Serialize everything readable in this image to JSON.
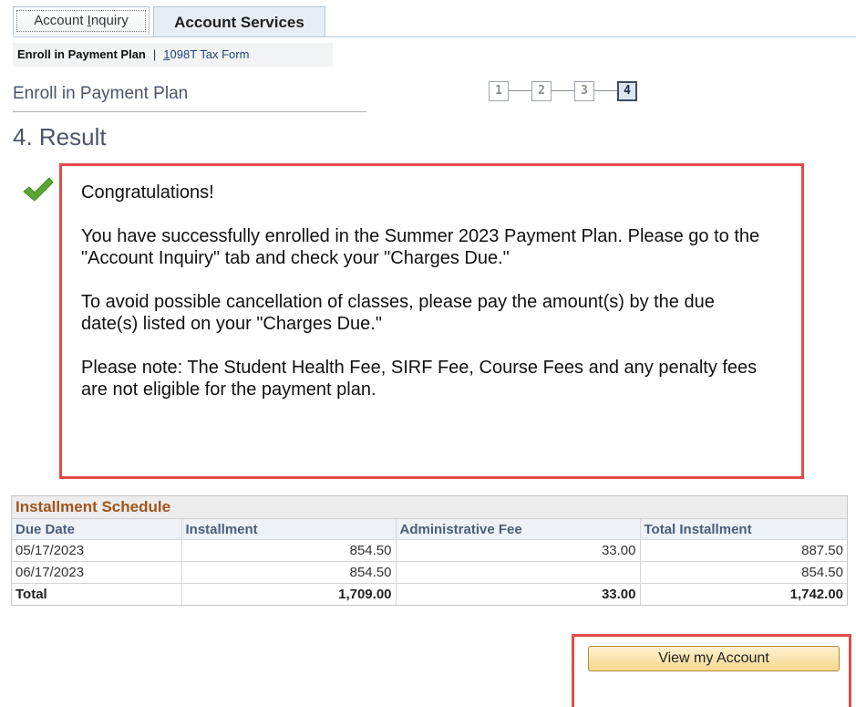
{
  "tabs": [
    {
      "label_prefix": "Account ",
      "label_underlined": "I",
      "label_suffix": "nquiry"
    },
    {
      "label": "Account Services"
    }
  ],
  "subnav": {
    "current": "Enroll in Payment Plan",
    "separator": "|",
    "link_underlined": "1",
    "link_rest": "098T Tax Form"
  },
  "page_title": "Enroll in Payment Plan",
  "steps": [
    "1",
    "2",
    "3",
    "4"
  ],
  "active_step": "4",
  "section_heading": "4. Result",
  "message": {
    "paragraphs": [
      "Congratulations!",
      "You have successfully enrolled in the Summer 2023 Payment Plan. Please go to the \"Account Inquiry\" tab and check your \"Charges Due.\"",
      "To avoid possible cancellation of classes, please pay the amount(s) by the due date(s) listed on your \"Charges Due.\"",
      "Please note:  The Student Health Fee, SIRF Fee, Course Fees and any penalty fees are not eligible for the payment plan."
    ]
  },
  "schedule": {
    "title": "Installment Schedule",
    "columns": [
      "Due Date",
      "Installment",
      "Administrative Fee",
      "Total Installment"
    ],
    "rows": [
      [
        "05/17/2023",
        "854.50",
        "33.00",
        "887.50"
      ],
      [
        "06/17/2023",
        "854.50",
        "",
        "854.50"
      ],
      [
        "Total",
        "1,709.00",
        "33.00",
        "1,742.00"
      ]
    ]
  },
  "button": {
    "label": "View my Account"
  },
  "colors": {
    "highlight_border": "#e74a4a",
    "schedule_title": "#a0541d",
    "success_check": "#5aa832"
  },
  "icons": {
    "success": "checkmark-icon"
  }
}
